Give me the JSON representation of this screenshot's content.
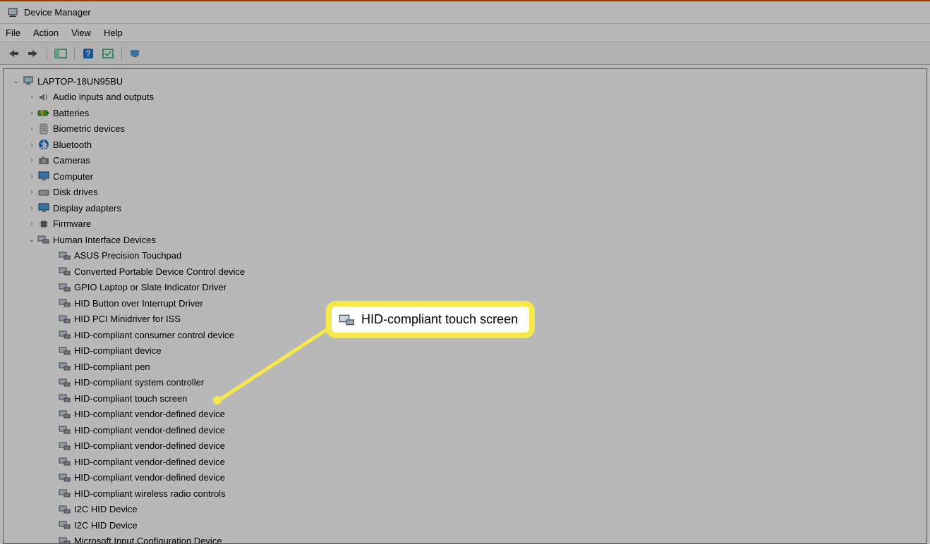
{
  "window": {
    "title": "Device Manager"
  },
  "menu": {
    "file": "File",
    "action": "Action",
    "view": "View",
    "help": "Help"
  },
  "tree": {
    "root": "LAPTOP-18UN95BU",
    "categories": [
      {
        "label": "Audio inputs and outputs",
        "icon": "speaker"
      },
      {
        "label": "Batteries",
        "icon": "battery"
      },
      {
        "label": "Biometric devices",
        "icon": "fingerprint"
      },
      {
        "label": "Bluetooth",
        "icon": "bluetooth"
      },
      {
        "label": "Cameras",
        "icon": "camera"
      },
      {
        "label": "Computer",
        "icon": "monitor"
      },
      {
        "label": "Disk drives",
        "icon": "disk"
      },
      {
        "label": "Display adapters",
        "icon": "monitor"
      },
      {
        "label": "Firmware",
        "icon": "chip"
      }
    ],
    "hid_label": "Human Interface Devices",
    "hid_children": [
      "ASUS Precision Touchpad",
      "Converted Portable Device Control device",
      "GPIO Laptop or Slate Indicator Driver",
      "HID Button over Interrupt Driver",
      "HID PCI Minidriver for ISS",
      "HID-compliant consumer control device",
      "HID-compliant device",
      "HID-compliant pen",
      "HID-compliant system controller",
      "HID-compliant touch screen",
      "HID-compliant vendor-defined device",
      "HID-compliant vendor-defined device",
      "HID-compliant vendor-defined device",
      "HID-compliant vendor-defined device",
      "HID-compliant vendor-defined device",
      "HID-compliant wireless radio controls",
      "I2C HID Device",
      "I2C HID Device",
      "Microsoft Input Configuration Device"
    ]
  },
  "callout": {
    "text": "HID-compliant touch screen"
  }
}
